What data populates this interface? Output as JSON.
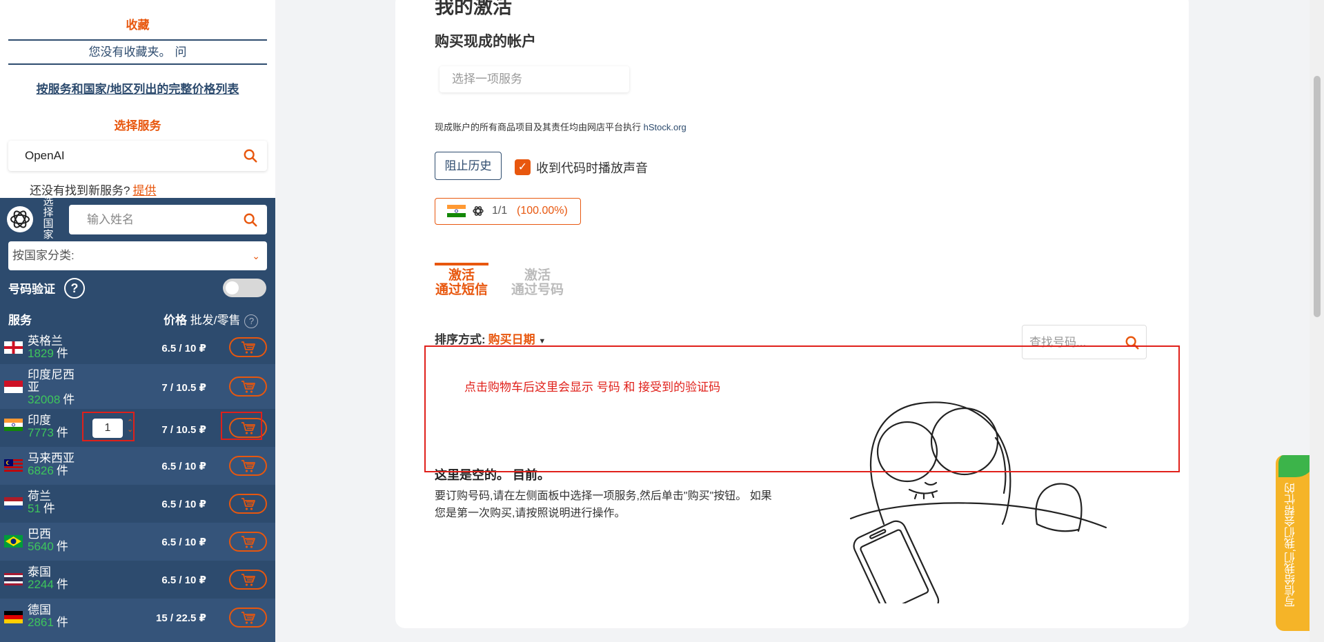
{
  "sidebar": {
    "favorites_heading": "收藏",
    "favorites_empty": "您没有收藏夹。",
    "favorites_help": "问",
    "price_list_link": "按服务和国家/地区列出的完整价格列表",
    "select_service_heading": "选择服务",
    "service_search_value": "OpenAI",
    "not_found_text": "还没有找到新服务?",
    "not_found_link": "提供",
    "country_label_vertical": "选择国家",
    "name_search_placeholder": "输入姓名",
    "sort_by_country": "按国家分类:",
    "number_verification": "号码验证",
    "help_mark": "?",
    "col_service": "服务",
    "col_price": "价格",
    "col_price_mode": "批发/零售",
    "rows": [
      {
        "name": "英格兰",
        "count": "1829",
        "unit": "件",
        "price": "6.5 / 10 ₽",
        "flag": "england"
      },
      {
        "name": "印度尼西亚",
        "count": "32008",
        "unit": "件",
        "price": "7 / 10.5 ₽",
        "flag": "indonesia"
      },
      {
        "name": "印度",
        "count": "7773",
        "unit": "件",
        "price": "7 / 10.5 ₽",
        "flag": "india",
        "qty": "1"
      },
      {
        "name": "马来西亚",
        "count": "6826",
        "unit": "件",
        "price": "6.5 / 10 ₽",
        "flag": "malaysia"
      },
      {
        "name": "荷兰",
        "count": "51",
        "unit": "件",
        "price": "6.5 / 10 ₽",
        "flag": "netherlands"
      },
      {
        "name": "巴西",
        "count": "5640",
        "unit": "件",
        "price": "6.5 / 10 ₽",
        "flag": "brazil"
      },
      {
        "name": "泰国",
        "count": "2244",
        "unit": "件",
        "price": "6.5 / 10 ₽",
        "flag": "thailand"
      },
      {
        "name": "德国",
        "count": "2861",
        "unit": "件",
        "price": "15 / 22.5 ₽",
        "flag": "germany"
      }
    ]
  },
  "main": {
    "title": "我的激活",
    "buy_accounts_heading": "购买现成的帐户",
    "service_select_placeholder": "选择一项服务",
    "note_text": "现成账户的所有商品项目及其责任均由网店平台执行",
    "note_link": "hStock.org",
    "block_history": "阻止历史",
    "sound_checkbox_label": "收到代码时播放声音",
    "stat_ratio": "1/1",
    "stat_percent": "(100.00%)",
    "tab_sms_line1": "激活",
    "tab_sms_line2": "通过短信",
    "tab_number_line1": "激活",
    "tab_number_line2": "通过号码",
    "sort_label": "排序方式:",
    "sort_value": "购买日期",
    "number_search_placeholder": "查找号码...",
    "empty_title": "这里是空的。 目前。",
    "empty_desc": "要订购号码,请在左侧面板中选择一项服务,然后单击\"购买\"按钮。 如果您是第一次购买,请按照说明进行操作。"
  },
  "annotation": {
    "text": "点击购物车后这里会显示 号码  和 接受到的验证码"
  },
  "feedback": {
    "label": "写信给我们,我们会帮忙的"
  },
  "colors": {
    "accent": "#e8570e",
    "navy": "#2d4b6e",
    "count_green": "#3ec65c",
    "annotation_red": "#e0201a"
  }
}
